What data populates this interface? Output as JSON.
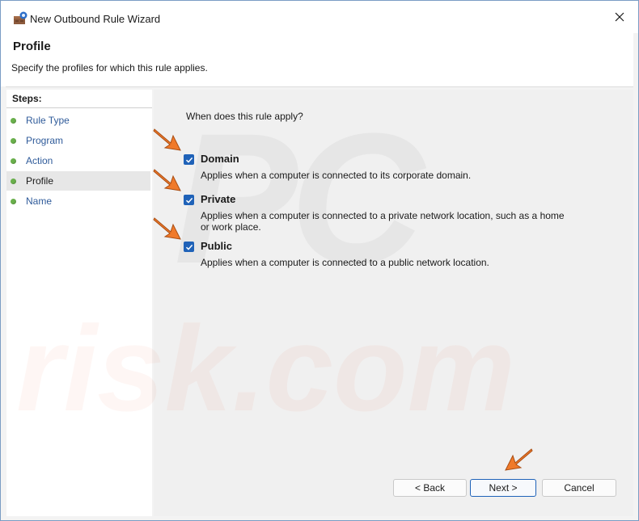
{
  "window": {
    "title": "New Outbound Rule Wizard"
  },
  "header": {
    "title": "Profile",
    "subtitle": "Specify the profiles for which this rule applies."
  },
  "steps": {
    "heading": "Steps:",
    "items": [
      {
        "label": "Rule Type",
        "active": false
      },
      {
        "label": "Program",
        "active": false
      },
      {
        "label": "Action",
        "active": false
      },
      {
        "label": "Profile",
        "active": true
      },
      {
        "label": "Name",
        "active": false
      }
    ]
  },
  "content": {
    "question": "When does this rule apply?",
    "options": [
      {
        "label": "Domain",
        "checked": true,
        "description": "Applies when a computer is connected to its corporate domain."
      },
      {
        "label": "Private",
        "checked": true,
        "description": "Applies when a computer is connected to a private network location, such as a home or work place."
      },
      {
        "label": "Public",
        "checked": true,
        "description": "Applies when a computer is connected to a public network location."
      }
    ]
  },
  "buttons": {
    "back": "< Back",
    "next": "Next >",
    "cancel": "Cancel"
  },
  "watermark": {
    "line1": "PC",
    "line2": "risk.com"
  },
  "colors": {
    "accent": "#1f62b8",
    "step_dot": "#6ab04c",
    "link": "#2f5b9a",
    "annotation_arrow": "#f07a2a"
  },
  "icons": {
    "app": "firewall-icon",
    "close": "close-icon",
    "check": "checkmark-icon",
    "pointer": "arrow-pointer-icon"
  }
}
